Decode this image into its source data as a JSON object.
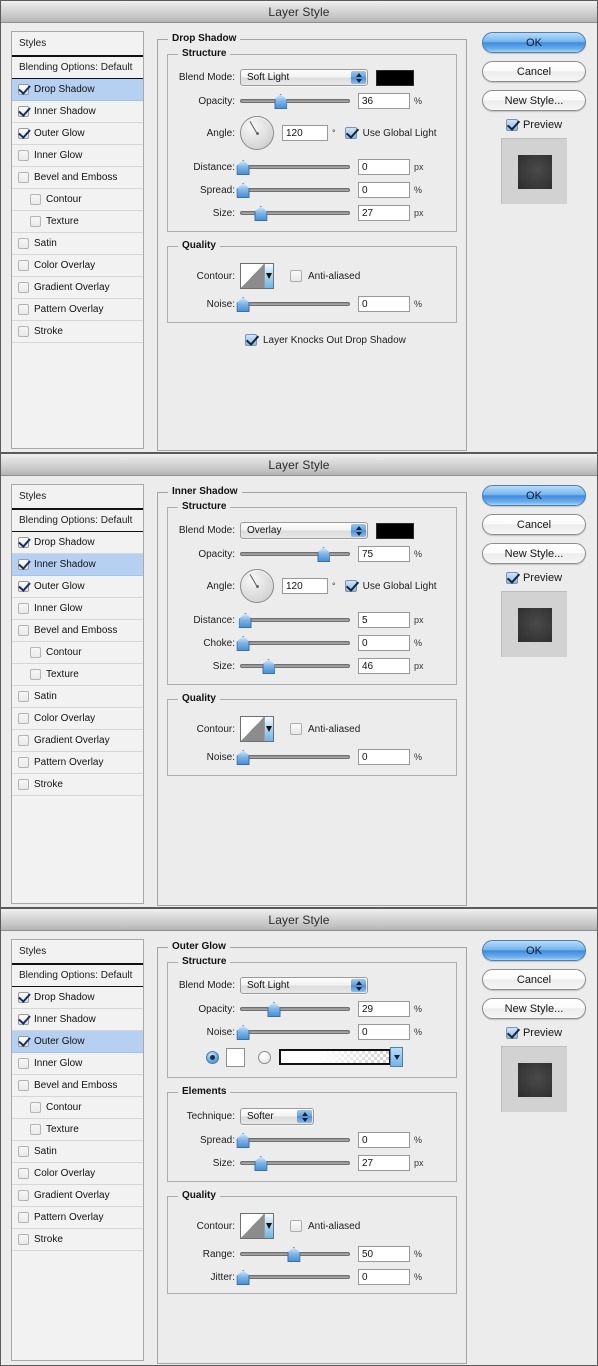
{
  "window": {
    "title": "Layer Style"
  },
  "styles_list": {
    "header": "Styles",
    "blending_options": "Blending Options: Default",
    "items": [
      {
        "label": "Drop Shadow",
        "checked": true,
        "indent": false
      },
      {
        "label": "Inner Shadow",
        "checked": true,
        "indent": false
      },
      {
        "label": "Outer Glow",
        "checked": true,
        "indent": false
      },
      {
        "label": "Inner Glow",
        "checked": false,
        "indent": false
      },
      {
        "label": "Bevel and Emboss",
        "checked": false,
        "indent": false
      },
      {
        "label": "Contour",
        "checked": false,
        "indent": true
      },
      {
        "label": "Texture",
        "checked": false,
        "indent": true
      },
      {
        "label": "Satin",
        "checked": false,
        "indent": false
      },
      {
        "label": "Color Overlay",
        "checked": false,
        "indent": false
      },
      {
        "label": "Gradient Overlay",
        "checked": false,
        "indent": false
      },
      {
        "label": "Pattern Overlay",
        "checked": false,
        "indent": false
      },
      {
        "label": "Stroke",
        "checked": false,
        "indent": false
      }
    ]
  },
  "buttons": {
    "ok": "OK",
    "cancel": "Cancel",
    "new_style": "New Style...",
    "preview": "Preview"
  },
  "labels": {
    "structure": "Structure",
    "quality": "Quality",
    "elements": "Elements",
    "blend_mode": "Blend Mode:",
    "opacity": "Opacity:",
    "angle": "Angle:",
    "use_global_light": "Use Global Light",
    "distance": "Distance:",
    "spread": "Spread:",
    "size": "Size:",
    "choke": "Choke:",
    "contour": "Contour:",
    "anti_aliased": "Anti-aliased",
    "noise": "Noise:",
    "layer_knocks_out": "Layer Knocks Out Drop Shadow",
    "technique": "Technique:",
    "range": "Range:",
    "jitter": "Jitter:",
    "degree": "°",
    "pct": "%",
    "px": "px"
  },
  "dialog1": {
    "section_title": "Drop Shadow",
    "selected_style_index": 0,
    "blend_mode": "Soft Light",
    "color": "#000000",
    "opacity": "36",
    "opacity_pct": 36,
    "angle": "120",
    "use_global_light": true,
    "distance": "0",
    "distance_pct": 0,
    "spread": "0",
    "spread_pct": 0,
    "size": "27",
    "size_pct": 18,
    "anti_aliased": false,
    "noise": "0",
    "noise_pct": 0,
    "layer_knocks_out": true
  },
  "dialog2": {
    "section_title": "Inner Shadow",
    "selected_style_index": 1,
    "blend_mode": "Overlay",
    "color": "#000000",
    "opacity": "75",
    "opacity_pct": 75,
    "angle": "120",
    "use_global_light": true,
    "distance": "5",
    "distance_pct": 4,
    "choke": "0",
    "choke_pct": 0,
    "size": "46",
    "size_pct": 23,
    "anti_aliased": false,
    "noise": "0",
    "noise_pct": 0
  },
  "dialog3": {
    "section_title": "Outer Glow",
    "selected_style_index": 2,
    "blend_mode": "Soft Light",
    "opacity": "29",
    "opacity_pct": 29,
    "noise": "0",
    "noise_pct": 0,
    "fill_type": "gradient",
    "color_swatch": "#ffffff",
    "technique": "Softer",
    "spread": "0",
    "spread_pct": 0,
    "size": "27",
    "size_pct": 18,
    "anti_aliased": false,
    "range": "50",
    "range_pct": 47,
    "jitter": "0",
    "jitter_pct": 0
  }
}
